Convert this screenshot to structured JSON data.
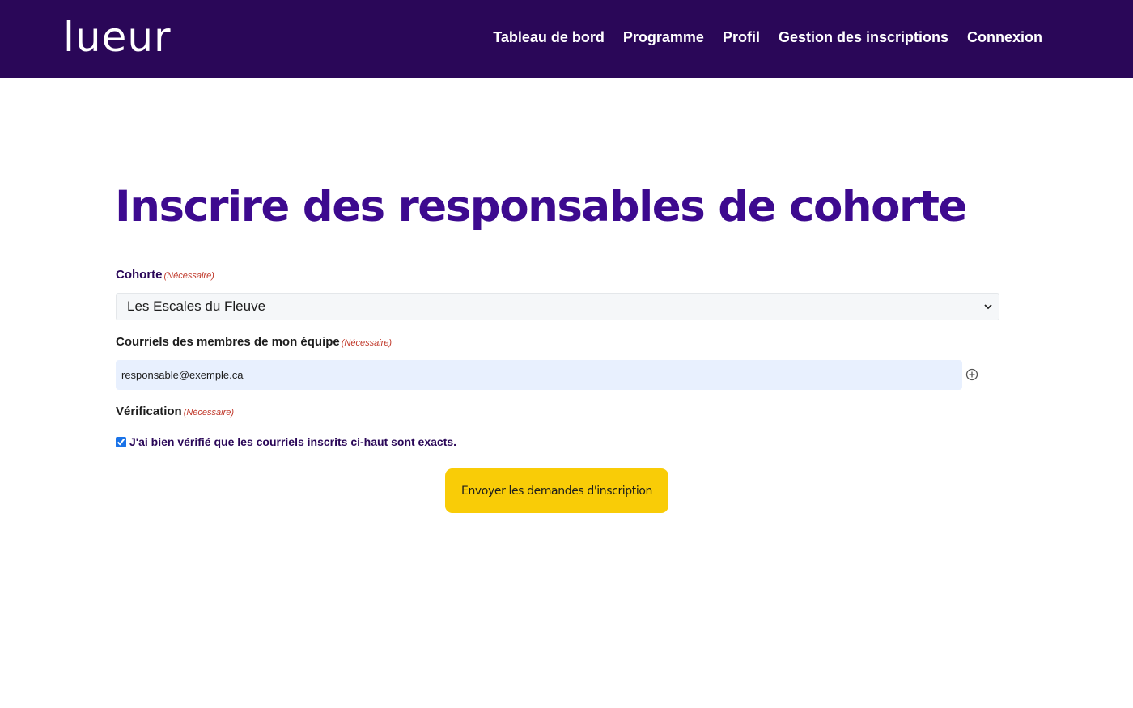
{
  "brand": {
    "logo_text": "lueur"
  },
  "nav": {
    "items": [
      {
        "label": "Tableau de bord"
      },
      {
        "label": "Programme"
      },
      {
        "label": "Profil"
      },
      {
        "label": "Gestion des inscriptions"
      },
      {
        "label": "Connexion"
      }
    ]
  },
  "page": {
    "title": "Inscrire des responsables de cohorte"
  },
  "form": {
    "required_text": "(Nécessaire)",
    "cohorte": {
      "label": "Cohorte",
      "selected": "Les Escales du Fleuve"
    },
    "emails": {
      "label": "Courriels des membres de mon équipe",
      "value": "responsable@exemple.ca"
    },
    "verification": {
      "label": "Vérification",
      "checkbox_label": "J'ai bien vérifié que les courriels inscrits ci-haut sont exacts.",
      "checked": true
    },
    "submit_label": "Envoyer les demandes d'inscription"
  },
  "icons": {
    "add": "plus-circle-icon",
    "select_arrow": "chevron-down-icon"
  },
  "colors": {
    "header_bg": "#2a0758",
    "title": "#3d0a8f",
    "accent_button": "#f9cc07",
    "required": "#c0392b"
  }
}
